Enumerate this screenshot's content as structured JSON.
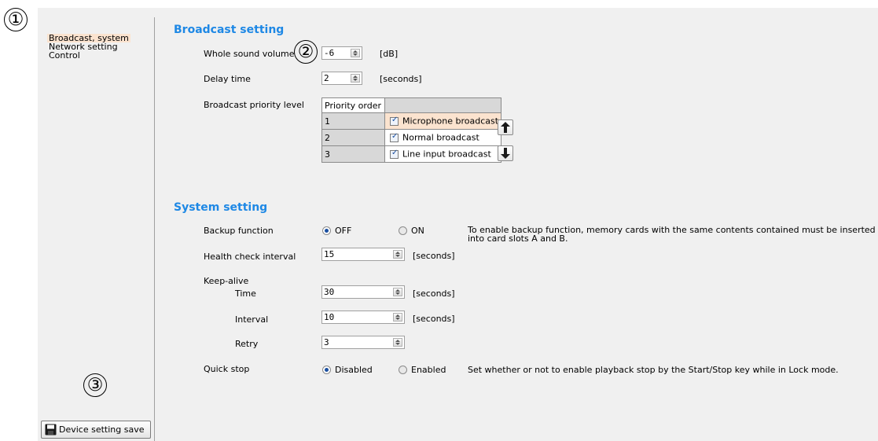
{
  "callouts": [
    "①",
    "②",
    "③"
  ],
  "sidebar": {
    "items": [
      {
        "label": "Broadcast, system",
        "selected": true
      },
      {
        "label": "Network setting",
        "selected": false
      },
      {
        "label": "Control",
        "selected": false
      }
    ],
    "save_label": "Device setting save"
  },
  "broadcast": {
    "title": "Broadcast setting",
    "whole_sound_volume": {
      "label": "Whole sound volume",
      "value": "-6",
      "unit": "[dB]"
    },
    "delay_time": {
      "label": "Delay time",
      "value": "2",
      "unit": "[seconds]"
    },
    "priority": {
      "label": "Broadcast priority level",
      "header": "Priority order",
      "rows": [
        {
          "order": "1",
          "name": "Microphone broadcast",
          "checked": true,
          "selected": true
        },
        {
          "order": "2",
          "name": "Normal broadcast",
          "checked": true,
          "selected": false
        },
        {
          "order": "3",
          "name": "Line input broadcast",
          "checked": true,
          "selected": false
        }
      ]
    }
  },
  "system": {
    "title": "System setting",
    "backup": {
      "label": "Backup function",
      "off_label": "OFF",
      "on_label": "ON",
      "selected": "OFF",
      "note_line1": "To enable backup function, memory cards with the same contents contained must be inserted",
      "note_line2": "into card slots A and B."
    },
    "health_check": {
      "label": "Health check interval",
      "value": "15",
      "unit": "[seconds]"
    },
    "keepalive": {
      "label": "Keep-alive",
      "time": {
        "label": "Time",
        "value": "30",
        "unit": "[seconds]"
      },
      "interval": {
        "label": "Interval",
        "value": "10",
        "unit": "[seconds]"
      },
      "retry": {
        "label": "Retry",
        "value": "3"
      }
    },
    "quick_stop": {
      "label": "Quick stop",
      "disabled_label": "Disabled",
      "enabled_label": "Enabled",
      "selected": "Disabled",
      "note": "Set whether or not to enable playback stop by the Start/Stop key while in Lock mode."
    }
  },
  "colors": {
    "accent": "#1e88e5",
    "selection": "#fbe3cf"
  }
}
